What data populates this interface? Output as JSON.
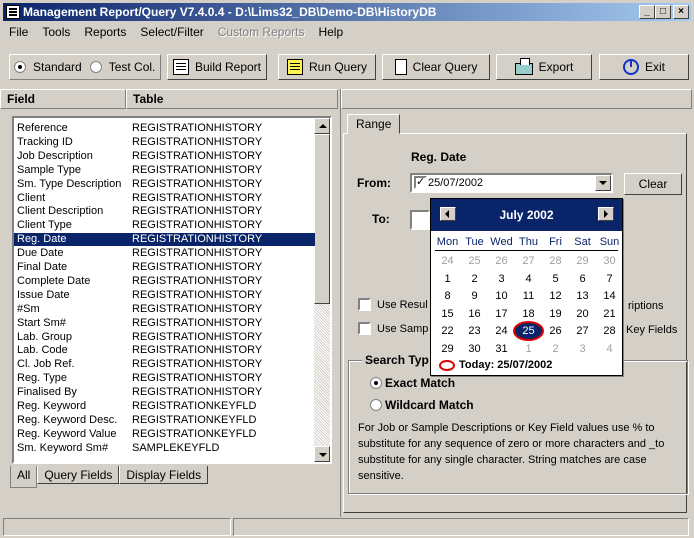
{
  "window": {
    "title": "Management Report/Query V7.4.0.4 - D:\\Lims32_DB\\Demo-DB\\HistoryDB",
    "buttons": [
      "_",
      "□",
      "×"
    ]
  },
  "menu": [
    {
      "label": "File",
      "enabled": true
    },
    {
      "label": "Tools",
      "enabled": true
    },
    {
      "label": "Reports",
      "enabled": true
    },
    {
      "label": "Select/Filter",
      "enabled": true
    },
    {
      "label": "Custom Reports",
      "enabled": false
    },
    {
      "label": "Help",
      "enabled": true
    }
  ],
  "toolbar": {
    "mode_standard": "Standard",
    "mode_test_col": "Test Col.",
    "build_report": "Build Report",
    "run_query": "Run Query",
    "clear_query": "Clear Query",
    "export": "Export",
    "exit": "Exit"
  },
  "left": {
    "col_field": "Field",
    "col_table": "Table",
    "rows": [
      {
        "field": "Reference",
        "table": "REGISTRATIONHISTORY"
      },
      {
        "field": "Tracking ID",
        "table": "REGISTRATIONHISTORY"
      },
      {
        "field": "Job Description",
        "table": "REGISTRATIONHISTORY"
      },
      {
        "field": "Sample Type",
        "table": "REGISTRATIONHISTORY"
      },
      {
        "field": "Sm. Type Description",
        "table": "REGISTRATIONHISTORY"
      },
      {
        "field": "Client",
        "table": "REGISTRATIONHISTORY"
      },
      {
        "field": "Client Description",
        "table": "REGISTRATIONHISTORY"
      },
      {
        "field": "Client Type",
        "table": "REGISTRATIONHISTORY"
      },
      {
        "field": "Reg. Date",
        "table": "REGISTRATIONHISTORY",
        "selected": true
      },
      {
        "field": "Due Date",
        "table": "REGISTRATIONHISTORY"
      },
      {
        "field": "Final Date",
        "table": "REGISTRATIONHISTORY"
      },
      {
        "field": "Complete Date",
        "table": "REGISTRATIONHISTORY"
      },
      {
        "field": "Issue Date",
        "table": "REGISTRATIONHISTORY"
      },
      {
        "field": "#Sm",
        "table": "REGISTRATIONHISTORY"
      },
      {
        "field": "Start Sm#",
        "table": "REGISTRATIONHISTORY"
      },
      {
        "field": "Lab. Group",
        "table": "REGISTRATIONHISTORY"
      },
      {
        "field": "Lab. Code",
        "table": "REGISTRATIONHISTORY"
      },
      {
        "field": "Cl. Job Ref.",
        "table": "REGISTRATIONHISTORY"
      },
      {
        "field": "Reg. Type",
        "table": "REGISTRATIONHISTORY"
      },
      {
        "field": "Finalised By",
        "table": "REGISTRATIONHISTORY"
      },
      {
        "field": "Reg. Keyword",
        "table": "REGISTRATIONKEYFLD"
      },
      {
        "field": "Reg. Keyword Desc.",
        "table": "REGISTRATIONKEYFLD"
      },
      {
        "field": "Reg. Keyword Value",
        "table": "REGISTRATIONKEYFLD"
      },
      {
        "field": "Sm. Keyword Sm#",
        "table": "SAMPLEKEYFLD"
      }
    ],
    "tabs": [
      "All",
      "Query Fields",
      "Display Fields"
    ]
  },
  "right": {
    "tab": "Range",
    "heading": "Reg. Date",
    "from_label": "From:",
    "to_label": "To:",
    "from_value": "25/07/2002",
    "from_checked": true,
    "clear": "Clear",
    "use_results_partial": "Use Resul",
    "descriptions_partial": "riptions",
    "use_sample_partial": "Use Samp",
    "key_fields_partial": "Key Fields",
    "search_type_partial": "Search Typ",
    "exact_match": "Exact Match",
    "wildcard_match": "Wildcard Match",
    "help_text": "For Job or Sample Descriptions or Key Field values use % to substitute for any sequence of zero or more characters and _to substitute for any single character. String matches are case sensitive."
  },
  "calendar": {
    "title": "July 2002",
    "days_of_week": [
      "Mon",
      "Tue",
      "Wed",
      "Thu",
      "Fri",
      "Sat",
      "Sun"
    ],
    "weeks": [
      [
        "24",
        "25",
        "26",
        "27",
        "28",
        "29",
        "30"
      ],
      [
        "1",
        "2",
        "3",
        "4",
        "5",
        "6",
        "7"
      ],
      [
        "8",
        "9",
        "10",
        "11",
        "12",
        "13",
        "14"
      ],
      [
        "15",
        "16",
        "17",
        "18",
        "19",
        "20",
        "21"
      ],
      [
        "22",
        "23",
        "24",
        "25",
        "26",
        "27",
        "28"
      ],
      [
        "29",
        "30",
        "31",
        "1",
        "2",
        "3",
        "4"
      ]
    ],
    "selected_day": "25",
    "today_label": "Today: 25/07/2002"
  }
}
